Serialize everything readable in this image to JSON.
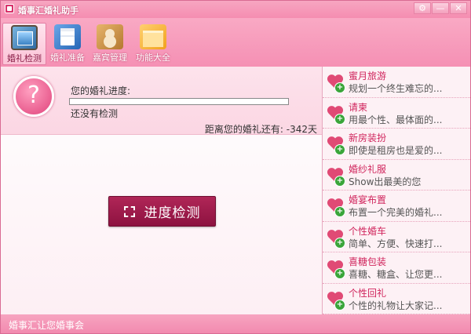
{
  "window": {
    "title": "婚事汇婚礼助手",
    "controls": [
      "⚙",
      "—",
      "✕"
    ]
  },
  "toolbar": {
    "items": [
      {
        "label": "婚礼检测",
        "icon": "monitor-icon",
        "active": true
      },
      {
        "label": "婚礼准备",
        "icon": "checklist-icon",
        "active": false
      },
      {
        "label": "嘉宾管理",
        "icon": "contacts-book-icon",
        "active": false
      },
      {
        "label": "功能大全",
        "icon": "folder-icon",
        "active": false
      }
    ]
  },
  "progress": {
    "label": "您的婚礼进度:",
    "value_fraction": 0,
    "status": "还没有检测",
    "countdown": "距离您的婚礼还有: -342天"
  },
  "main": {
    "detect_button": "进度检测"
  },
  "sidebar": {
    "items": [
      {
        "title": "蜜月旅游",
        "desc": "规划一个终生难忘的..."
      },
      {
        "title": "请柬",
        "desc": "用最个性、最体面的..."
      },
      {
        "title": "新房装扮",
        "desc": "即使是租房也是爱的..."
      },
      {
        "title": "婚纱礼服",
        "desc": "Show出最美的您"
      },
      {
        "title": "婚宴布置",
        "desc": "布置一个完美的婚礼..."
      },
      {
        "title": "个性婚车",
        "desc": "简单、方便、快速打..."
      },
      {
        "title": "喜糖包装",
        "desc": "喜糖、糖盒、让您更..."
      },
      {
        "title": "个性回礼",
        "desc": "个性的礼物让大家记..."
      }
    ]
  },
  "statusbar": {
    "text": "婚事汇让您婚事会"
  },
  "colors": {
    "accent": "#f590b4",
    "button": "#8d1240",
    "heart": "#e04a75"
  }
}
